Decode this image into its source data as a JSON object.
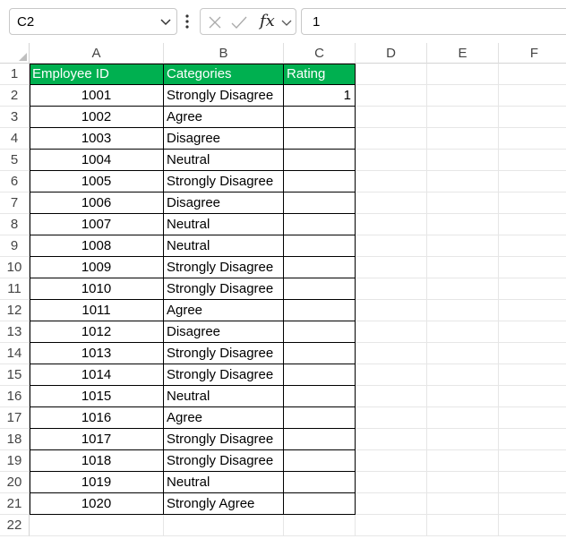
{
  "formula_bar": {
    "name_box": "C2",
    "fx_label": "fx",
    "formula_value": "1"
  },
  "columns": [
    "A",
    "B",
    "C",
    "D",
    "E",
    "F"
  ],
  "header_row": {
    "a": "Employee ID",
    "b": "Categories",
    "c": "Rating"
  },
  "rows": [
    {
      "n": "1"
    },
    {
      "n": "2",
      "id": "1001",
      "cat": "Strongly Disagree",
      "rating": "1"
    },
    {
      "n": "3",
      "id": "1002",
      "cat": "Agree",
      "rating": ""
    },
    {
      "n": "4",
      "id": "1003",
      "cat": "Disagree",
      "rating": ""
    },
    {
      "n": "5",
      "id": "1004",
      "cat": "Neutral",
      "rating": ""
    },
    {
      "n": "6",
      "id": "1005",
      "cat": "Strongly Disagree",
      "rating": ""
    },
    {
      "n": "7",
      "id": "1006",
      "cat": "Disagree",
      "rating": ""
    },
    {
      "n": "8",
      "id": "1007",
      "cat": "Neutral",
      "rating": ""
    },
    {
      "n": "9",
      "id": "1008",
      "cat": "Neutral",
      "rating": ""
    },
    {
      "n": "10",
      "id": "1009",
      "cat": "Strongly Disagree",
      "rating": ""
    },
    {
      "n": "11",
      "id": "1010",
      "cat": "Strongly Disagree",
      "rating": ""
    },
    {
      "n": "12",
      "id": "1011",
      "cat": "Agree",
      "rating": ""
    },
    {
      "n": "13",
      "id": "1012",
      "cat": "Disagree",
      "rating": ""
    },
    {
      "n": "14",
      "id": "1013",
      "cat": "Strongly Disagree",
      "rating": ""
    },
    {
      "n": "15",
      "id": "1014",
      "cat": "Strongly Disagree",
      "rating": ""
    },
    {
      "n": "16",
      "id": "1015",
      "cat": "Neutral",
      "rating": ""
    },
    {
      "n": "17",
      "id": "1016",
      "cat": "Agree",
      "rating": ""
    },
    {
      "n": "18",
      "id": "1017",
      "cat": "Strongly Disagree",
      "rating": ""
    },
    {
      "n": "19",
      "id": "1018",
      "cat": "Strongly Disagree",
      "rating": ""
    },
    {
      "n": "20",
      "id": "1019",
      "cat": "Neutral",
      "rating": ""
    },
    {
      "n": "21",
      "id": "1020",
      "cat": "Strongly Agree",
      "rating": ""
    },
    {
      "n": "22"
    }
  ],
  "colors": {
    "header_fill": "#00b050",
    "header_text": "#ffffff"
  }
}
